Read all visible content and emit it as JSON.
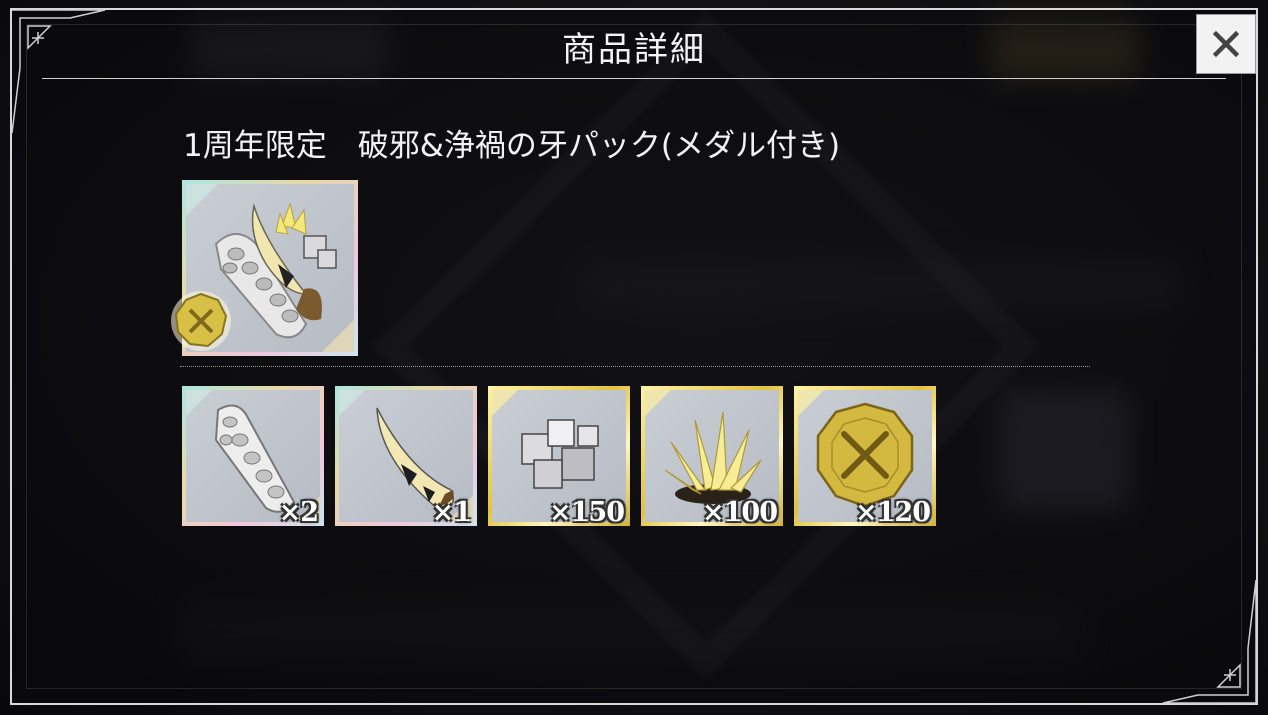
{
  "dialog": {
    "title": "商品詳細",
    "close_label": "×"
  },
  "product": {
    "name": "1周年限定　破邪&浄禍の牙パック(メダル付き)",
    "pack_icon": "fang-pack-icon",
    "medal_icon": "medal-icon"
  },
  "contents": [
    {
      "icon": "scaled-horn-icon",
      "quantity": "×2",
      "frame": "rainbow"
    },
    {
      "icon": "striped-fang-icon",
      "quantity": "×1",
      "frame": "rainbow"
    },
    {
      "icon": "silver-ore-icon",
      "quantity": "×150",
      "frame": "gold"
    },
    {
      "icon": "gold-crystal-icon",
      "quantity": "×100",
      "frame": "gold"
    },
    {
      "icon": "gold-medal-icon",
      "quantity": "×120",
      "frame": "gold"
    }
  ],
  "colors": {
    "frame_border": "#d9d9d9",
    "text": "#f2f2f2",
    "gold": "#e3c33c"
  }
}
